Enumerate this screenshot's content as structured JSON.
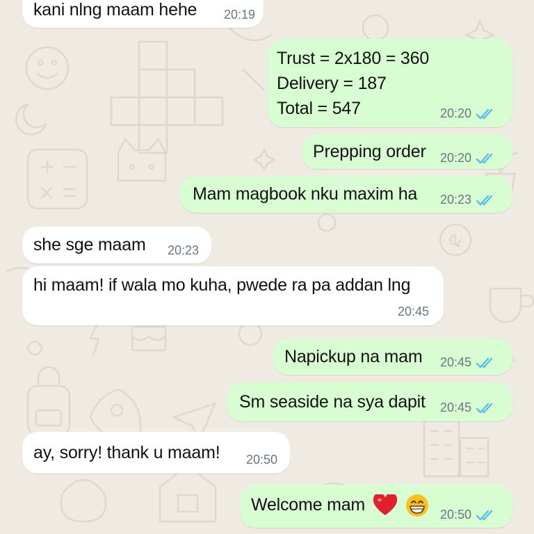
{
  "colors": {
    "wallpaper": "#efeae2",
    "incoming_bubble": "#ffffff",
    "outgoing_bubble": "#d9fdd3",
    "timestamp": "#667781",
    "read_ticks": "#53bdeb"
  },
  "messages": [
    {
      "direction": "incoming",
      "lines": [
        "kani nlng maam hehe"
      ],
      "time": "20:19"
    },
    {
      "direction": "outgoing",
      "lines": [
        "Trust = 2x180 = 360",
        "Delivery = 187",
        "Total = 547"
      ],
      "time": "20:20",
      "status": "read"
    },
    {
      "direction": "outgoing",
      "lines": [
        "Prepping order"
      ],
      "time": "20:20",
      "status": "read"
    },
    {
      "direction": "outgoing",
      "lines": [
        "Mam magbook nku maxim ha"
      ],
      "time": "20:23",
      "status": "read"
    },
    {
      "direction": "incoming",
      "lines": [
        "she sge maam"
      ],
      "time": "20:23"
    },
    {
      "direction": "incoming",
      "lines": [
        "hi maam! if wala mo kuha, pwede ra pa addan lng"
      ],
      "time": "20:45"
    },
    {
      "direction": "outgoing",
      "lines": [
        "Napickup na mam"
      ],
      "time": "20:45",
      "status": "read"
    },
    {
      "direction": "outgoing",
      "lines": [
        "Sm seaside na sya dapit"
      ],
      "time": "20:45",
      "status": "read"
    },
    {
      "direction": "incoming",
      "lines": [
        "ay, sorry! thank u maam!"
      ],
      "time": "20:50"
    },
    {
      "direction": "outgoing",
      "lines": [
        "Welcome mam"
      ],
      "emojis": [
        "red-heart",
        "grinning-face-with-smiling-eyes"
      ],
      "time": "20:50",
      "status": "read"
    }
  ]
}
